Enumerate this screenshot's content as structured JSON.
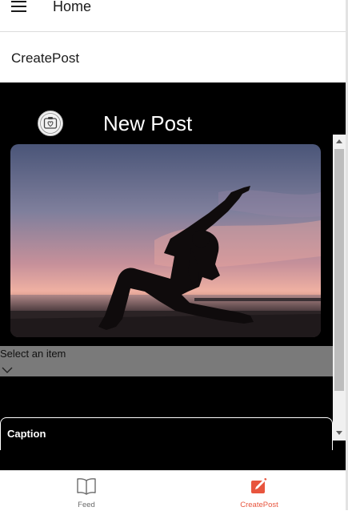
{
  "header": {
    "title": "Home"
  },
  "page": {
    "heading": "CreatePost"
  },
  "post": {
    "title": "New Post",
    "picker": {
      "placeholder": "Select an item"
    },
    "caption": {
      "label": "Caption"
    }
  },
  "tabs": [
    {
      "label": "Feed",
      "icon": "book-open-icon",
      "active": false
    },
    {
      "label": "CreatePost",
      "icon": "edit-square-icon",
      "active": true
    }
  ],
  "colors": {
    "accent": "#e8553e",
    "content_background": "#000000",
    "picker_background": "#7a7a7a",
    "inactive_tab": "#6b6b6b"
  }
}
